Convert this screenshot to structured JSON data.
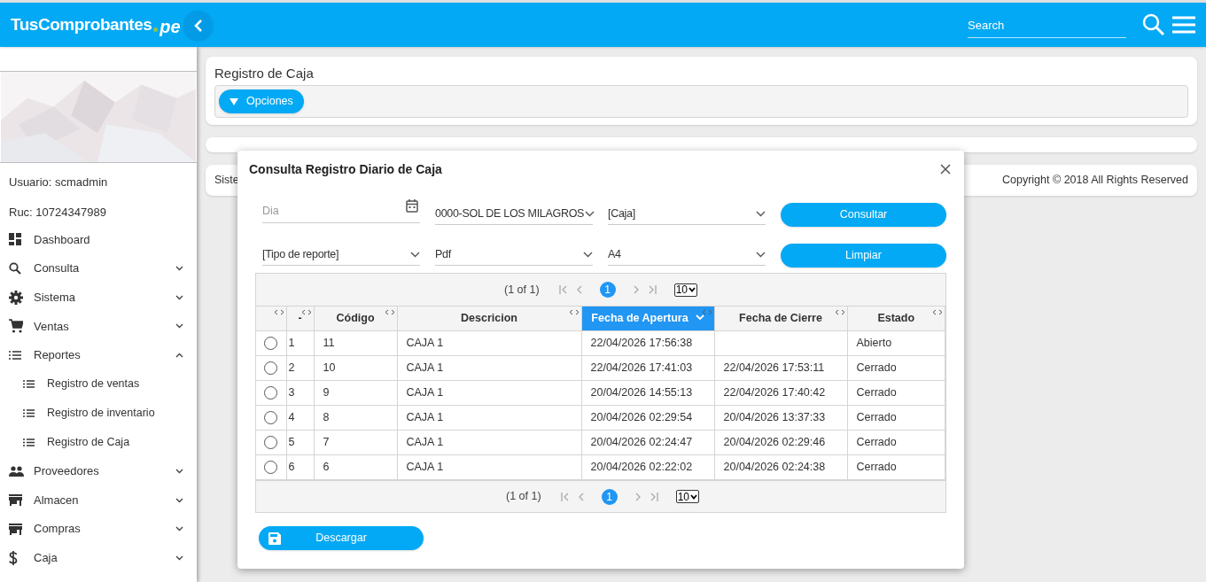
{
  "header": {
    "brand": "TusComprobantes",
    "brand_suffix": "pe",
    "search": {
      "placeholder": "Search"
    }
  },
  "sidebar": {
    "user": "Usuario: scmadmin",
    "ruc": "Ruc: 10724347989",
    "items": [
      {
        "label": "Dashboard"
      },
      {
        "label": "Consulta",
        "expanded": false
      },
      {
        "label": "Sistema",
        "expanded": false
      },
      {
        "label": "Ventas",
        "expanded": false
      },
      {
        "label": "Reportes",
        "expanded": true,
        "children": [
          {
            "label": "Registro de ventas"
          },
          {
            "label": "Registro de inventario"
          },
          {
            "label": "Registro de Caja"
          }
        ]
      },
      {
        "label": "Proveedores",
        "expanded": false
      },
      {
        "label": "Almacen",
        "expanded": false
      },
      {
        "label": "Compras",
        "expanded": false
      },
      {
        "label": "Caja",
        "expanded": false
      }
    ]
  },
  "page": {
    "title": "Registro de Caja",
    "options_button": "Opciones",
    "footer_left": "Siste",
    "copyright": "Copyright © 2018 All Rights Reserved"
  },
  "dialog": {
    "title": "Consulta Registro Diario de Caja",
    "fields": [
      {
        "kind": "date",
        "placeholder": "Dia"
      },
      {
        "kind": "select",
        "value": "0000-SOL DE LOS MILAGROS"
      },
      {
        "kind": "select",
        "value": "[Caja]"
      },
      {
        "kind": "button",
        "label": "Consultar"
      },
      {
        "kind": "select",
        "value": "[Tipo de reporte]"
      },
      {
        "kind": "select",
        "value": "Pdf"
      },
      {
        "kind": "select",
        "value": "A4"
      },
      {
        "kind": "button",
        "label": "Limpiar"
      }
    ],
    "paginators": [
      {
        "summary": "(1 of 1)",
        "page": "1",
        "rows_per_page": "10"
      },
      {
        "summary": "(1 of 1)",
        "page": "1",
        "rows_per_page": "10"
      }
    ],
    "columns": [
      {
        "label": "-",
        "sorted": false
      },
      {
        "label": "Código",
        "sorted": false
      },
      {
        "label": "Descricion",
        "sorted": false
      },
      {
        "label": "Fecha de Apertura",
        "sorted": true
      },
      {
        "label": "Fecha de Cierre",
        "sorted": false
      },
      {
        "label": "Estado",
        "sorted": false
      }
    ],
    "rows": [
      {
        "selected": false,
        "cells": [
          "1",
          "11",
          "CAJA 1",
          "22/04/2026 17:56:38",
          "",
          "Abierto"
        ]
      },
      {
        "selected": false,
        "cells": [
          "2",
          "10",
          "CAJA 1",
          "22/04/2026 17:41:03",
          "22/04/2026 17:53:11",
          "Cerrado"
        ]
      },
      {
        "selected": false,
        "cells": [
          "3",
          "9",
          "CAJA 1",
          "20/04/2026 14:55:13",
          "22/04/2026 17:40:42",
          "Cerrado"
        ]
      },
      {
        "selected": false,
        "cells": [
          "4",
          "8",
          "CAJA 1",
          "20/04/2026 02:29:54",
          "20/04/2026 13:37:33",
          "Cerrado"
        ]
      },
      {
        "selected": false,
        "cells": [
          "5",
          "7",
          "CAJA 1",
          "20/04/2026 02:24:47",
          "20/04/2026 02:29:46",
          "Cerrado"
        ]
      },
      {
        "selected": false,
        "cells": [
          "6",
          "6",
          "CAJA 1",
          "20/04/2026 02:22:02",
          "20/04/2026 02:24:38",
          "Cerrado"
        ]
      }
    ],
    "download_button": "Descargar"
  }
}
